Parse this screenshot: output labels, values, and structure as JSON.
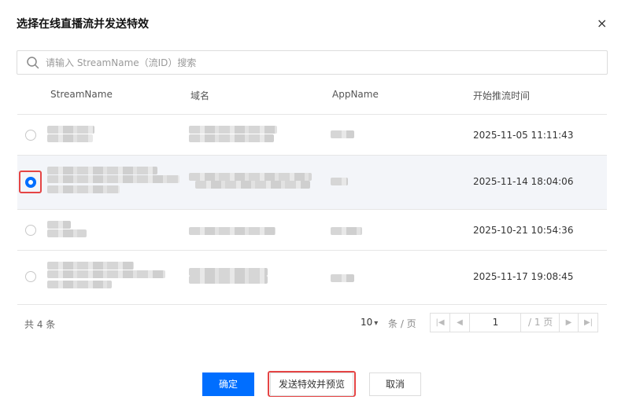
{
  "dialog": {
    "title": "选择在线直播流并发送特效",
    "close_label": "×"
  },
  "search": {
    "placeholder": "请输入 StreamName（流ID）搜索",
    "value": ""
  },
  "table": {
    "headers": [
      "StreamName",
      "域名",
      "AppName",
      "开始推流时间"
    ],
    "rows": [
      {
        "selected": false,
        "start_time": "2025-11-05 11:11:43"
      },
      {
        "selected": true,
        "start_time": "2025-11-14 18:04:06"
      },
      {
        "selected": false,
        "start_time": "2025-10-21 10:54:36"
      },
      {
        "selected": false,
        "start_time": "2025-11-17 19:08:45"
      }
    ]
  },
  "pagination": {
    "total_text": "共 4 条",
    "page_size": "10",
    "per_page_text": "条 / 页",
    "current_page": "1",
    "total_pages_text": "/ 1 页"
  },
  "footer": {
    "confirm_label": "确定",
    "send_preview_label": "发送特效并预览",
    "cancel_label": "取消"
  },
  "colors": {
    "primary": "#006eff",
    "highlight": "#e54545",
    "selected_row_bg": "#f3f5f9"
  }
}
